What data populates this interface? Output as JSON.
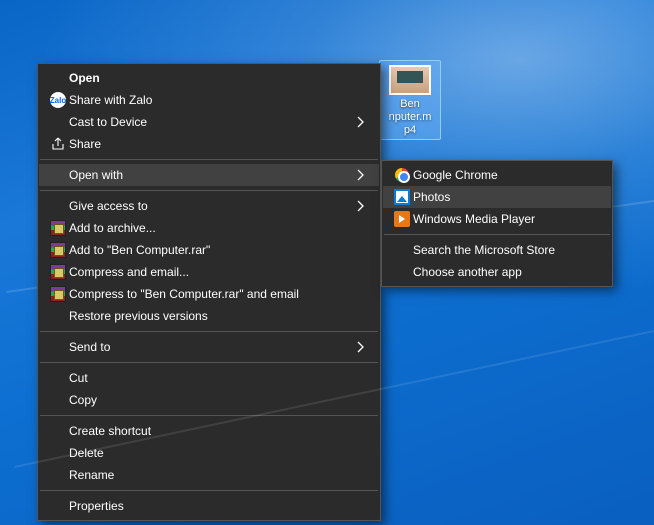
{
  "file": {
    "name_line1": "Ben",
    "name_line2": "nputer.m",
    "name_line3": "p4"
  },
  "menu": {
    "open": "Open",
    "share_zalo": "Share with Zalo",
    "cast": "Cast to Device",
    "share": "Share",
    "open_with": "Open with",
    "give_access": "Give access to",
    "add_archive": "Add to archive...",
    "add_to_rar": "Add to \"Ben Computer.rar\"",
    "compress_email": "Compress and email...",
    "compress_to_email": "Compress to \"Ben Computer.rar\" and email",
    "restore": "Restore previous versions",
    "send_to": "Send to",
    "cut": "Cut",
    "copy": "Copy",
    "create_shortcut": "Create shortcut",
    "delete": "Delete",
    "rename": "Rename",
    "properties": "Properties"
  },
  "submenu": {
    "chrome": "Google Chrome",
    "photos": "Photos",
    "wmp": "Windows Media Player",
    "search_store": "Search the Microsoft Store",
    "choose": "Choose another app"
  },
  "icons": {
    "zalo_text": "Zalo"
  }
}
